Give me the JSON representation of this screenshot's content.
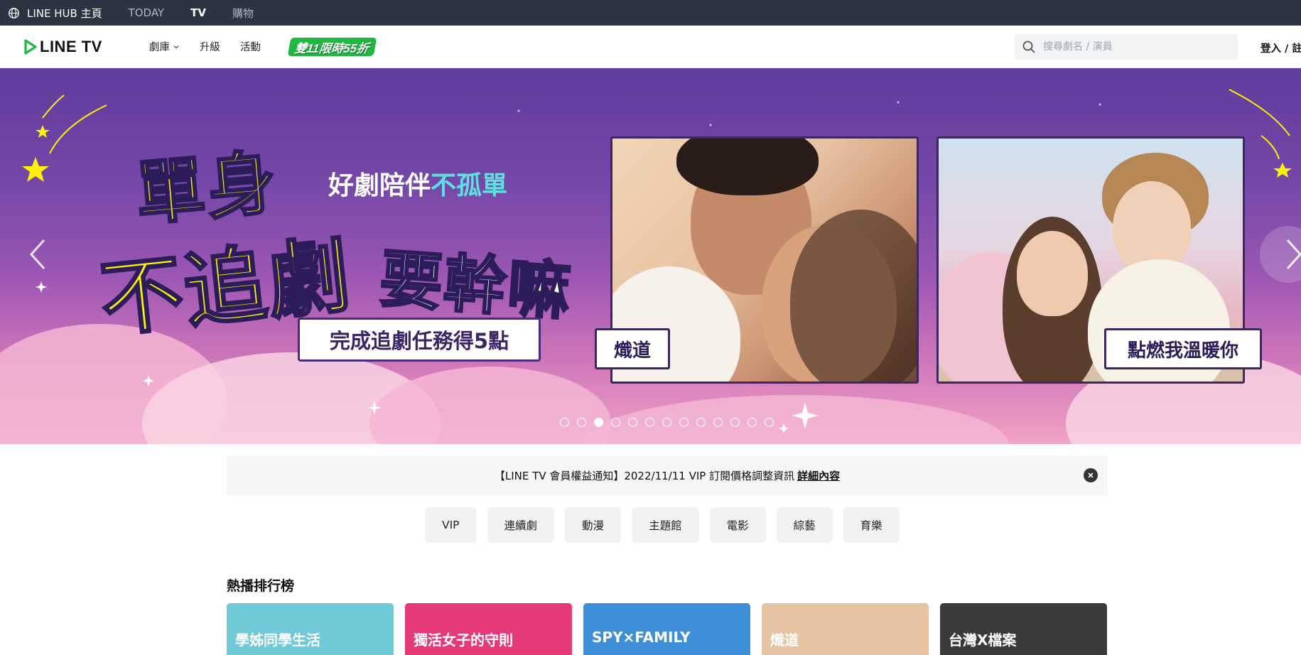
{
  "hub": {
    "home_label": "LINE HUB 主頁",
    "links": [
      "TODAY",
      "TV",
      "購物"
    ],
    "active": "TV"
  },
  "header": {
    "logo_text": "LINE TV",
    "nav": [
      {
        "label": "劇庫",
        "has_dropdown": true
      },
      {
        "label": "升級",
        "has_dropdown": false
      },
      {
        "label": "活動",
        "has_dropdown": false
      }
    ],
    "promo_text": "雙11限時55折",
    "search_placeholder": "搜尋劇名 / 演員",
    "login_label": "登入 / 註冊"
  },
  "hero": {
    "headline_line1": "單身",
    "headline_line2a": "不追劇",
    "headline_line2b": "要幹嘛",
    "tagline_prefix": "好劇陪伴",
    "tagline_highlight": "不孤單",
    "mission_label": "完成追劇任務得5點",
    "posters": [
      {
        "title": "熾道"
      },
      {
        "title": "點燃我溫暖你"
      }
    ],
    "dots_total": 13,
    "dots_active_index": 2
  },
  "notice": {
    "text": "【LINE TV 會員權益通知】2022/11/11 VIP 訂閱價格調整資訊",
    "link_label": "詳細內容"
  },
  "categories": [
    "VIP",
    "連續劇",
    "動漫",
    "主題館",
    "電影",
    "綜藝",
    "育樂"
  ],
  "ranking": {
    "title": "熱播排行榜",
    "cards": [
      {
        "label": "學姊同學生活",
        "color": "#6fc9d6"
      },
      {
        "label": "獨活女子的守則",
        "color": "#e63a78"
      },
      {
        "label": "SPY×FAMILY",
        "color": "#3f8fd8"
      },
      {
        "label": "熾道",
        "color": "#e6c3a2"
      },
      {
        "label": "台灣X檔案",
        "color": "#3a3a3a"
      }
    ]
  },
  "colors": {
    "hub_bg": "#2b3440",
    "brand_green": "#1fb841",
    "hero_purple": "#5f3d9c",
    "hero_pink": "#f2a2c5",
    "headline_yellow": "#fff200"
  }
}
